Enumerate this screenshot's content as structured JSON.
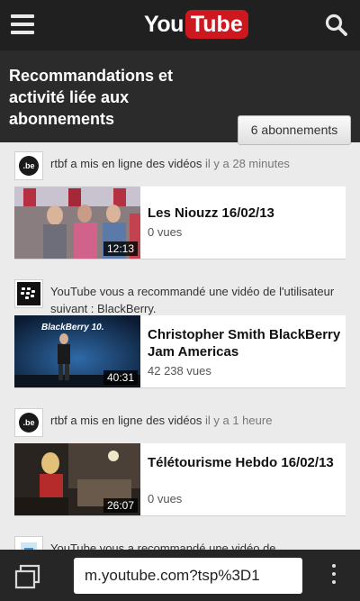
{
  "topbar": {
    "logo_you": "You",
    "logo_tube": "Tube",
    "menu_icon": "hamburger-menu-icon",
    "search_icon": "search-icon"
  },
  "header": {
    "title": "Recommandations et activité liée aux abonnements",
    "subscriptions_button": "6 abonnements"
  },
  "feed": [
    {
      "source_icon": "be-channel-logo",
      "source_text": "rtbf a mis en ligne des vidéos",
      "time": "il y a 28 minutes",
      "video_title": "Les Niouzz 16/02/13",
      "views": "0 vues",
      "duration": "12:13"
    },
    {
      "source_icon": "blackberry-logo",
      "source_text": "YouTube vous a recommandé une vidéo de l'utilisateur suivant : BlackBerry.",
      "time": "",
      "video_title": "Christopher Smith BlackBerry Jam Americas",
      "views": "42 238 vues",
      "duration": "40:31",
      "thumb_caption": "BlackBerry 10."
    },
    {
      "source_icon": "be-channel-logo",
      "source_text": "rtbf a mis en ligne des vidéos",
      "time": "il y a 1 heure",
      "video_title": "Télétourisme Hebdo 16/02/13",
      "views": "0 vues",
      "duration": "26:07"
    },
    {
      "source_text": "YouTube vous a recommandé une vidéo de"
    }
  ],
  "bottombar": {
    "url": "m.youtube.com?tsp%3D1",
    "tabs_icon": "tabs-icon",
    "more_icon": "more-vertical-icon"
  }
}
